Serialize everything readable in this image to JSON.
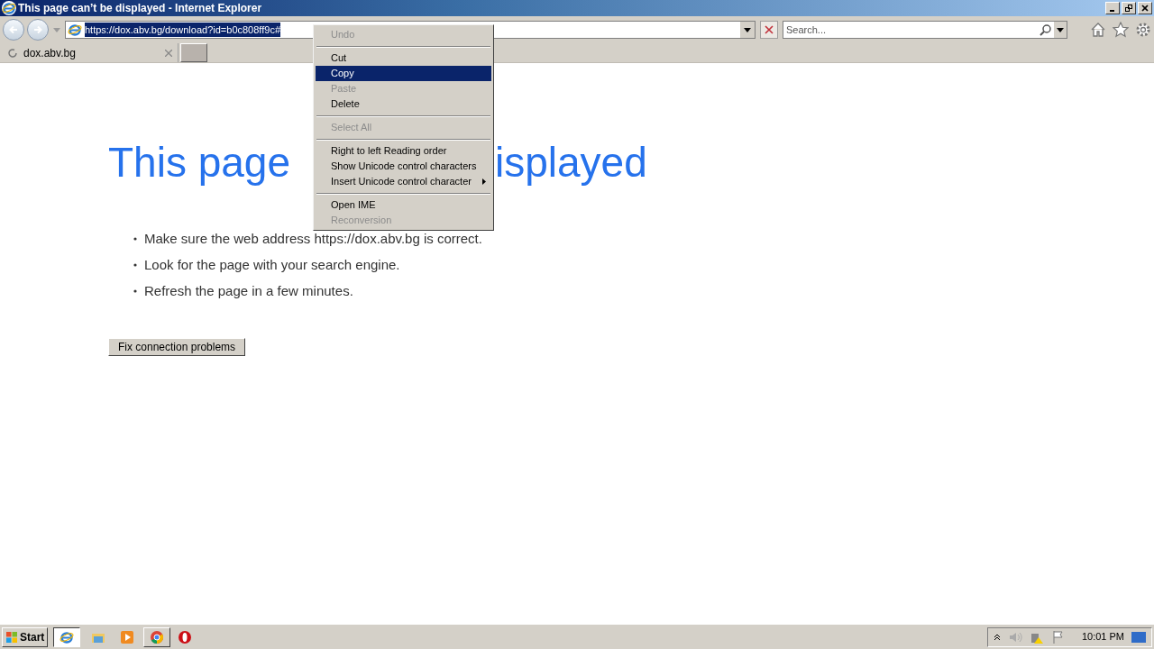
{
  "window": {
    "title": "This page can’t be displayed - Internet Explorer"
  },
  "address_bar": {
    "value": "https://dox.abv.bg/download?id=b0c808ff9c#",
    "selected": true
  },
  "search": {
    "placeholder": "Search..."
  },
  "tabs": [
    {
      "label": "dox.abv.bg",
      "selected": true
    }
  ],
  "page": {
    "heading_start": "This page",
    "heading_end": "isplayed",
    "bullets": [
      "Make sure the web address https://dox.abv.bg is correct.",
      "Look for the page with your search engine.",
      "Refresh the page in a few minutes."
    ],
    "button": "Fix connection problems"
  },
  "context_menu": [
    {
      "kind": "item",
      "label": "Undo",
      "disabled": true,
      "selected": false,
      "submenu": false
    },
    {
      "kind": "separator"
    },
    {
      "kind": "item",
      "label": "Cut",
      "disabled": false,
      "selected": false,
      "submenu": false
    },
    {
      "kind": "item",
      "label": "Copy",
      "disabled": false,
      "selected": true,
      "submenu": false
    },
    {
      "kind": "item",
      "label": "Paste",
      "disabled": true,
      "selected": false,
      "submenu": false
    },
    {
      "kind": "item",
      "label": "Delete",
      "disabled": false,
      "selected": false,
      "submenu": false
    },
    {
      "kind": "separator"
    },
    {
      "kind": "item",
      "label": "Select All",
      "disabled": true,
      "selected": false,
      "submenu": false
    },
    {
      "kind": "separator"
    },
    {
      "kind": "item",
      "label": "Right to left Reading order",
      "disabled": false,
      "selected": false,
      "submenu": false
    },
    {
      "kind": "item",
      "label": "Show Unicode control characters",
      "disabled": false,
      "selected": false,
      "submenu": false
    },
    {
      "kind": "item",
      "label": "Insert Unicode control character",
      "disabled": false,
      "selected": false,
      "submenu": true
    },
    {
      "kind": "separator"
    },
    {
      "kind": "item",
      "label": "Open IME",
      "disabled": false,
      "selected": false,
      "submenu": false
    },
    {
      "kind": "item",
      "label": "Reconversion",
      "disabled": true,
      "selected": false,
      "submenu": false
    }
  ],
  "taskbar": {
    "start": "Start",
    "clock": "10:01 PM"
  }
}
